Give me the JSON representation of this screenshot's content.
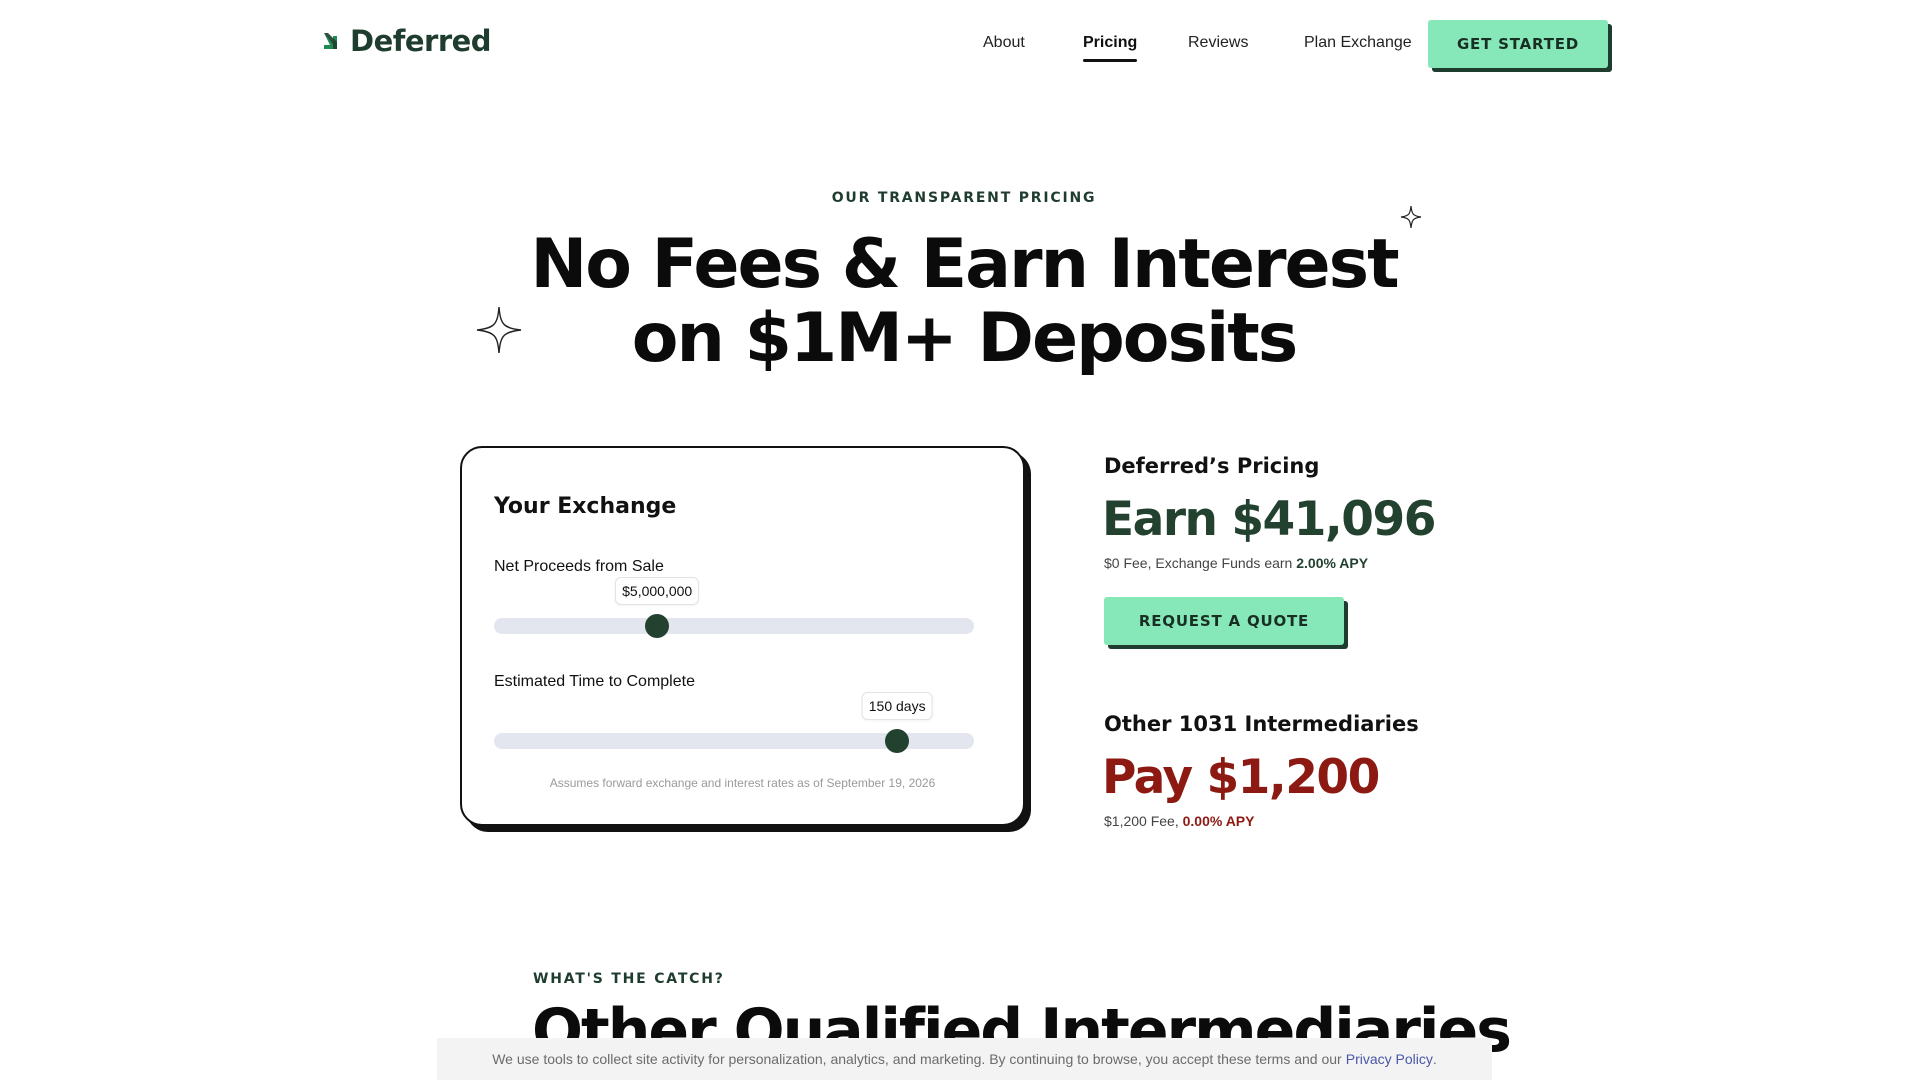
{
  "header": {
    "logo_text": "Deferred",
    "nav": [
      {
        "label": "About"
      },
      {
        "label": "Pricing",
        "active": true
      },
      {
        "label": "Reviews"
      },
      {
        "label": "Plan Exchange"
      }
    ],
    "cta_label": "GET STARTED"
  },
  "hero": {
    "eyebrow": "OUR TRANSPARENT PRICING",
    "title_line1": "No Fees & Earn Interest",
    "title_line2": "on $1M+ Deposits"
  },
  "calculator": {
    "title": "Your Exchange",
    "proceeds": {
      "label": "Net Proceeds from Sale",
      "value_text": "$5,000,000",
      "fraction": 0.34
    },
    "time": {
      "label": "Estimated Time to Complete",
      "value_text": "150 days",
      "fraction": 0.84
    },
    "note": "Assumes forward exchange and interest rates as of September 19, 2026"
  },
  "pricing": {
    "deferred": {
      "heading": "Deferred’s Pricing",
      "amount": "Earn $41,096",
      "sub_prefix": "$0 Fee, Exchange Funds earn",
      "sub_rate": "2.00% APY",
      "button": "REQUEST A QUOTE"
    },
    "others": {
      "heading": "Other 1031 Intermediaries",
      "amount": "Pay $1,200",
      "sub_prefix": "$1,200 Fee,",
      "sub_rate": "0.00% APY"
    }
  },
  "catch": {
    "eyebrow": "WHAT'S THE CATCH?",
    "title": "Other Qualified Intermediaries"
  },
  "cookie": {
    "text": "We use tools to collect site activity for personalization, analytics, and marketing. By continuing to browse, you accept these terms and our",
    "link": "Privacy Policy",
    "suffix": "."
  },
  "colors": {
    "brand_green": "#1f3d2e",
    "accent_mint": "#86e8b8",
    "danger_red": "#8c1a12",
    "slider_track": "#e4e6ef"
  },
  "icons": [
    "logo-arrow-icon",
    "sparkle-icon"
  ]
}
